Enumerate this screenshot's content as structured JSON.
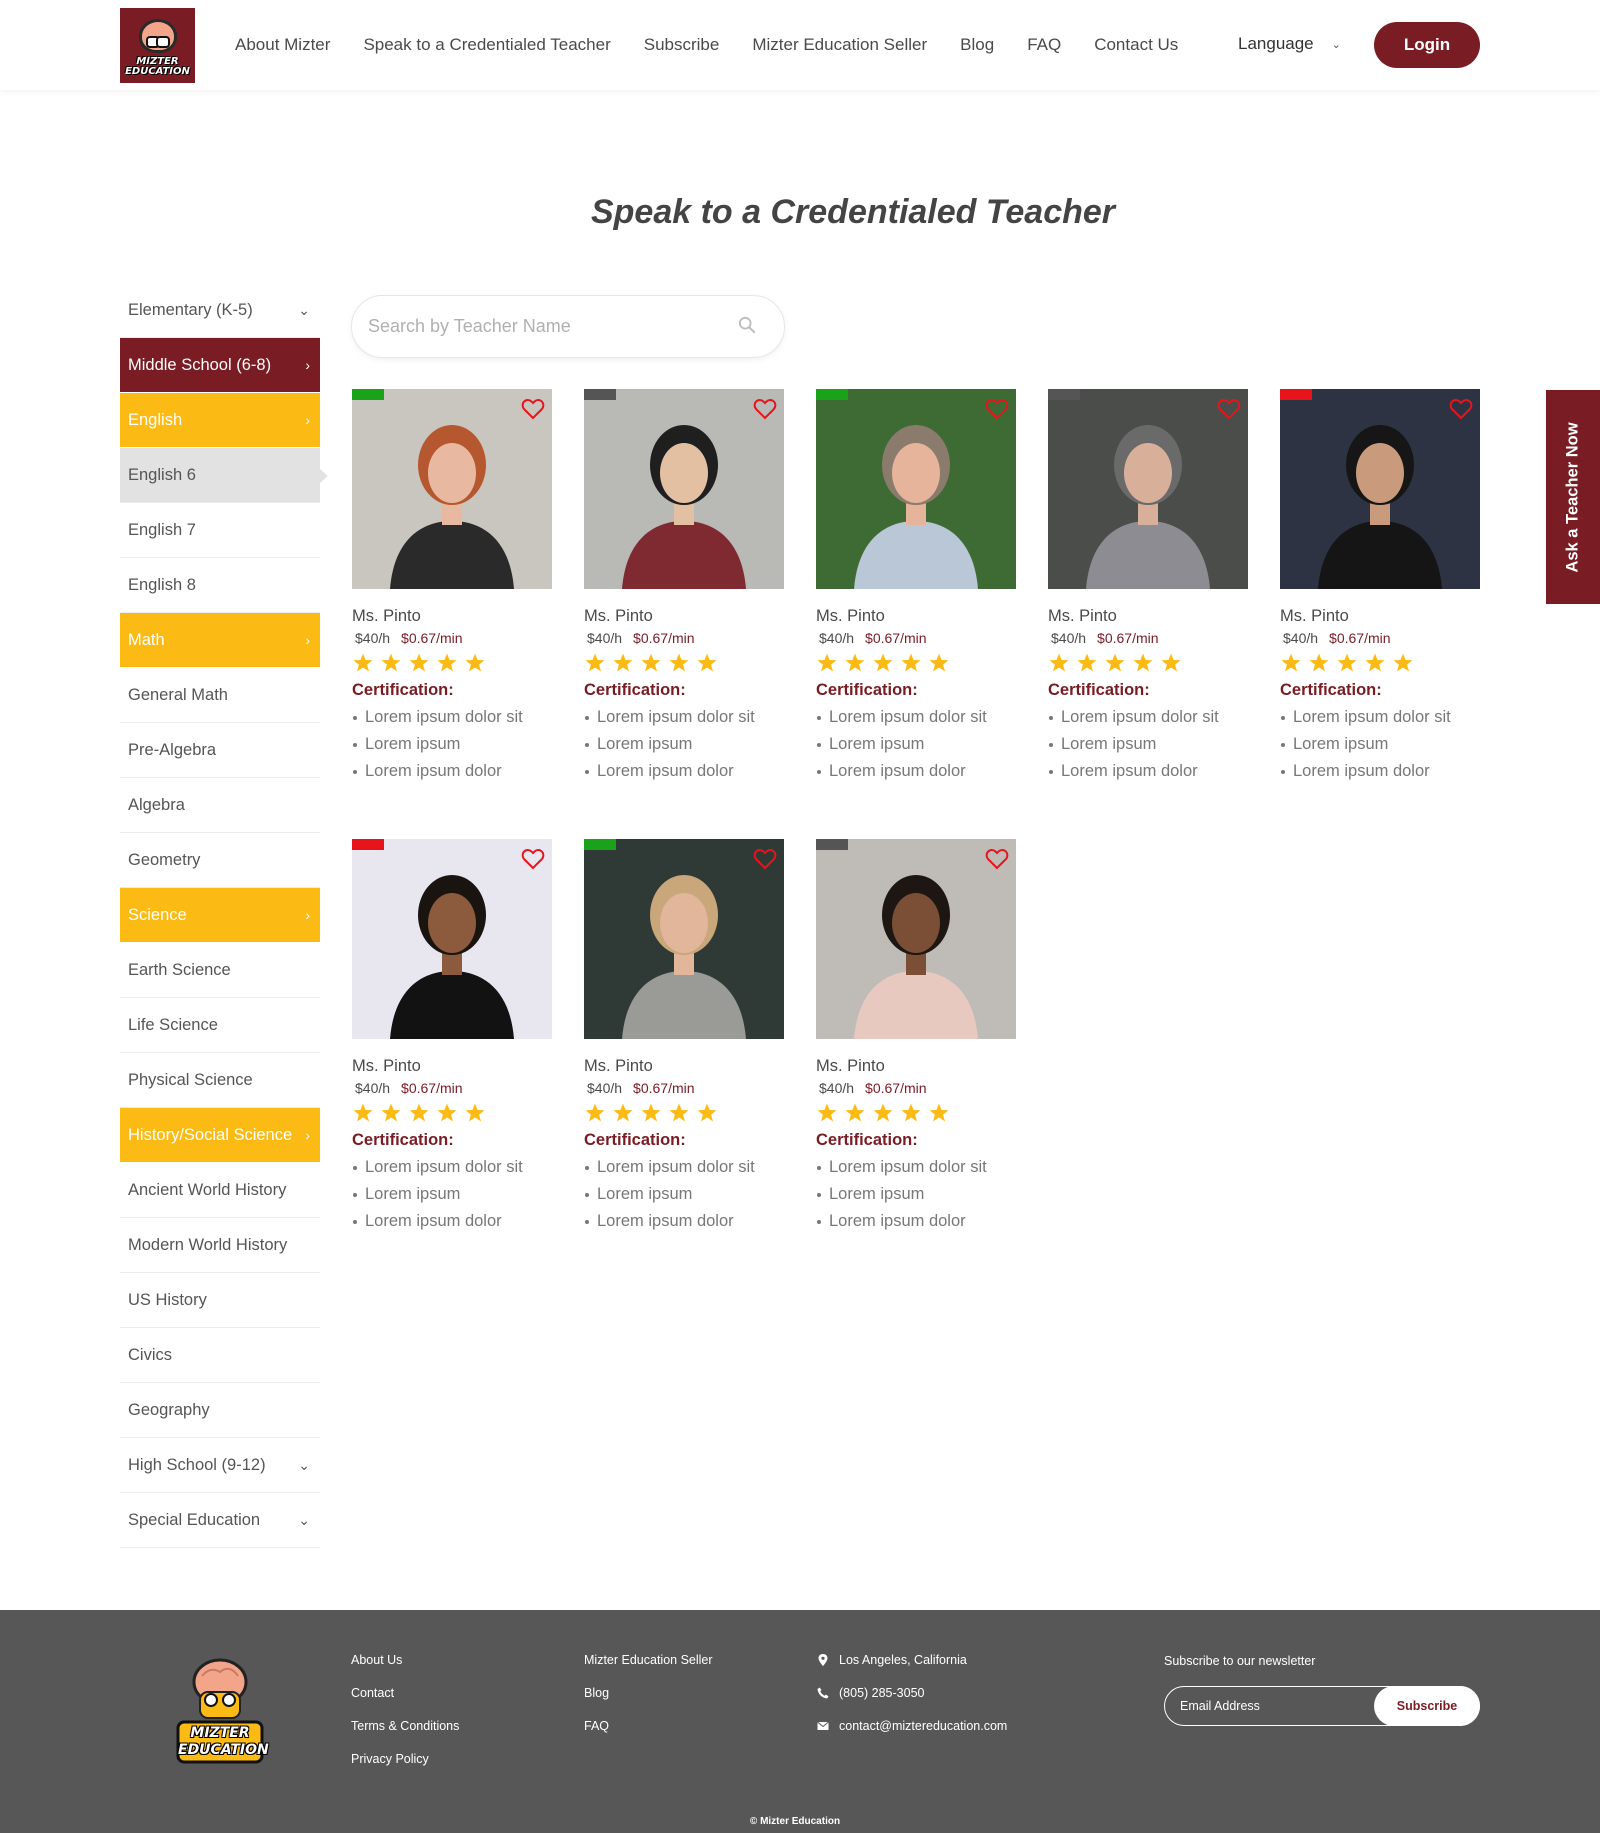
{
  "header": {
    "logo_text": "MIZTER EDUCATION",
    "nav": [
      {
        "label": "About Mizter"
      },
      {
        "label": "Speak to a Credentialed Teacher"
      },
      {
        "label": "Subscribe"
      },
      {
        "label": "Mizter Education Seller"
      },
      {
        "label": "Blog"
      },
      {
        "label": "FAQ"
      },
      {
        "label": "Contact Us"
      }
    ],
    "language_label": "Language",
    "login_label": "Login"
  },
  "page_title": "Speak to a Credentialed Teacher",
  "sidebar": {
    "items": [
      {
        "label": "Elementary (K-5)",
        "type": "level",
        "arrow": "⌄"
      },
      {
        "label": "Middle School (6-8)",
        "type": "level-active",
        "arrow": "›"
      },
      {
        "label": "English",
        "type": "subject",
        "arrow": "›"
      },
      {
        "label": "English 6",
        "type": "selected",
        "arrow": ""
      },
      {
        "label": "English 7",
        "type": "course",
        "arrow": ""
      },
      {
        "label": "English 8",
        "type": "course",
        "arrow": ""
      },
      {
        "label": "Math",
        "type": "subject",
        "arrow": "›"
      },
      {
        "label": "General Math",
        "type": "course",
        "arrow": ""
      },
      {
        "label": "Pre-Algebra",
        "type": "course",
        "arrow": ""
      },
      {
        "label": "Algebra",
        "type": "course",
        "arrow": ""
      },
      {
        "label": "Geometry",
        "type": "course",
        "arrow": ""
      },
      {
        "label": "Science",
        "type": "subject",
        "arrow": "›"
      },
      {
        "label": "Earth Science",
        "type": "course",
        "arrow": ""
      },
      {
        "label": "Life Science",
        "type": "course",
        "arrow": ""
      },
      {
        "label": "Physical Science",
        "type": "course",
        "arrow": ""
      },
      {
        "label": "History/Social Science",
        "type": "subject twoline",
        "arrow": "›"
      },
      {
        "label": "Ancient World History",
        "type": "course",
        "arrow": ""
      },
      {
        "label": "Modern World History",
        "type": "course",
        "arrow": ""
      },
      {
        "label": "US History",
        "type": "course",
        "arrow": ""
      },
      {
        "label": "Civics",
        "type": "course",
        "arrow": ""
      },
      {
        "label": "Geography",
        "type": "course",
        "arrow": ""
      },
      {
        "label": "High School (9-12)",
        "type": "level",
        "arrow": "⌄"
      },
      {
        "label": "Special Education",
        "type": "level",
        "arrow": "⌄"
      }
    ]
  },
  "search": {
    "placeholder": "Search by Teacher Name"
  },
  "certification_label": "Certification:",
  "teachers": [
    {
      "name": "Ms. Pinto",
      "rate_hour": "$40/h",
      "rate_min": "$0.67/min",
      "rating": 5,
      "status_color": "#1aa31a",
      "photo": {
        "bg": "#c9c6c0",
        "fg": "#2a2a2a",
        "skin": "#e8b9a0",
        "hair": "#b5582f"
      },
      "certs": [
        "Lorem ipsum dolor sit",
        "Lorem ipsum",
        "Lorem ipsum dolor"
      ]
    },
    {
      "name": "Ms. Pinto",
      "rate_hour": "$40/h",
      "rate_min": "$0.67/min",
      "rating": 5,
      "status_color": "#555555",
      "photo": {
        "bg": "#b9b9b6",
        "fg": "#7e2a30",
        "skin": "#e3c0a2",
        "hair": "#1f1f1f"
      },
      "certs": [
        "Lorem ipsum dolor sit",
        "Lorem ipsum",
        "Lorem ipsum dolor"
      ]
    },
    {
      "name": "Ms. Pinto",
      "rate_hour": "$40/h",
      "rate_min": "$0.67/min",
      "rating": 5,
      "status_color": "#1aa31a",
      "photo": {
        "bg": "#3e6b34",
        "fg": "#b9c7d6",
        "skin": "#e6b49a",
        "hair": "#8a7b6c"
      },
      "certs": [
        "Lorem ipsum dolor sit",
        "Lorem ipsum",
        "Lorem ipsum dolor"
      ]
    },
    {
      "name": "Ms. Pinto",
      "rate_hour": "$40/h",
      "rate_min": "$0.67/min",
      "rating": 5,
      "status_color": "#555555",
      "photo": {
        "bg": "#4a4d4a",
        "fg": "#8d8c93",
        "skin": "#d8b09a",
        "hair": "#6a6a6a"
      },
      "certs": [
        "Lorem ipsum dolor sit",
        "Lorem ipsum",
        "Lorem ipsum dolor"
      ]
    },
    {
      "name": "Ms. Pinto",
      "rate_hour": "$40/h",
      "rate_min": "$0.67/min",
      "rating": 5,
      "status_color": "#e8141b",
      "photo": {
        "bg": "#2d3342",
        "fg": "#151515",
        "skin": "#c99a7c",
        "hair": "#161616"
      },
      "certs": [
        "Lorem ipsum dolor sit",
        "Lorem ipsum",
        "Lorem ipsum dolor"
      ]
    },
    {
      "name": "Ms. Pinto",
      "rate_hour": "$40/h",
      "rate_min": "$0.67/min",
      "rating": 5,
      "status_color": "#e8141b",
      "photo": {
        "bg": "#e8e6ef",
        "fg": "#121212",
        "skin": "#8c5a3c",
        "hair": "#1a1410"
      },
      "certs": [
        "Lorem ipsum dolor sit",
        "Lorem ipsum",
        "Lorem ipsum dolor"
      ]
    },
    {
      "name": "Ms. Pinto",
      "rate_hour": "$40/h",
      "rate_min": "$0.67/min",
      "rating": 5,
      "status_color": "#1aa31a",
      "photo": {
        "bg": "#2f3a36",
        "fg": "#9a9a96",
        "skin": "#e2b69a",
        "hair": "#c9a77a"
      },
      "certs": [
        "Lorem ipsum dolor sit",
        "Lorem ipsum",
        "Lorem ipsum dolor"
      ]
    },
    {
      "name": "Ms. Pinto",
      "rate_hour": "$40/h",
      "rate_min": "$0.67/min",
      "rating": 5,
      "status_color": "#555555",
      "photo": {
        "bg": "#bfbcb8",
        "fg": "#e8c9bf",
        "skin": "#7a4f35",
        "hair": "#1d1612"
      },
      "certs": [
        "Lorem ipsum dolor sit",
        "Lorem ipsum",
        "Lorem ipsum dolor"
      ]
    }
  ],
  "side_tab_label": "Ask a Teacher Now",
  "footer": {
    "links_col1": [
      "About Us",
      "Contact",
      "Terms & Conditions",
      "Privacy Policy"
    ],
    "links_col2": [
      "Mizter Education Seller",
      "Blog",
      "FAQ"
    ],
    "contact": [
      {
        "icon": "location-pin-icon",
        "text": "Los Angeles, California"
      },
      {
        "icon": "phone-icon",
        "text": "(805) 285-3050"
      },
      {
        "icon": "mail-icon",
        "text": "contact@miztereducation.com"
      }
    ],
    "newsletter_label": "Subscribe to our newsletter",
    "email_placeholder": "Email Address",
    "subscribe_label": "Subscribe",
    "copyright": "© Mizter Education"
  },
  "colors": {
    "brand": "#7a1c24",
    "accent": "#fcbb14",
    "footer_bg": "#575757",
    "status_online": "#1aa31a",
    "status_busy": "#e8141b",
    "status_offline": "#555555"
  }
}
